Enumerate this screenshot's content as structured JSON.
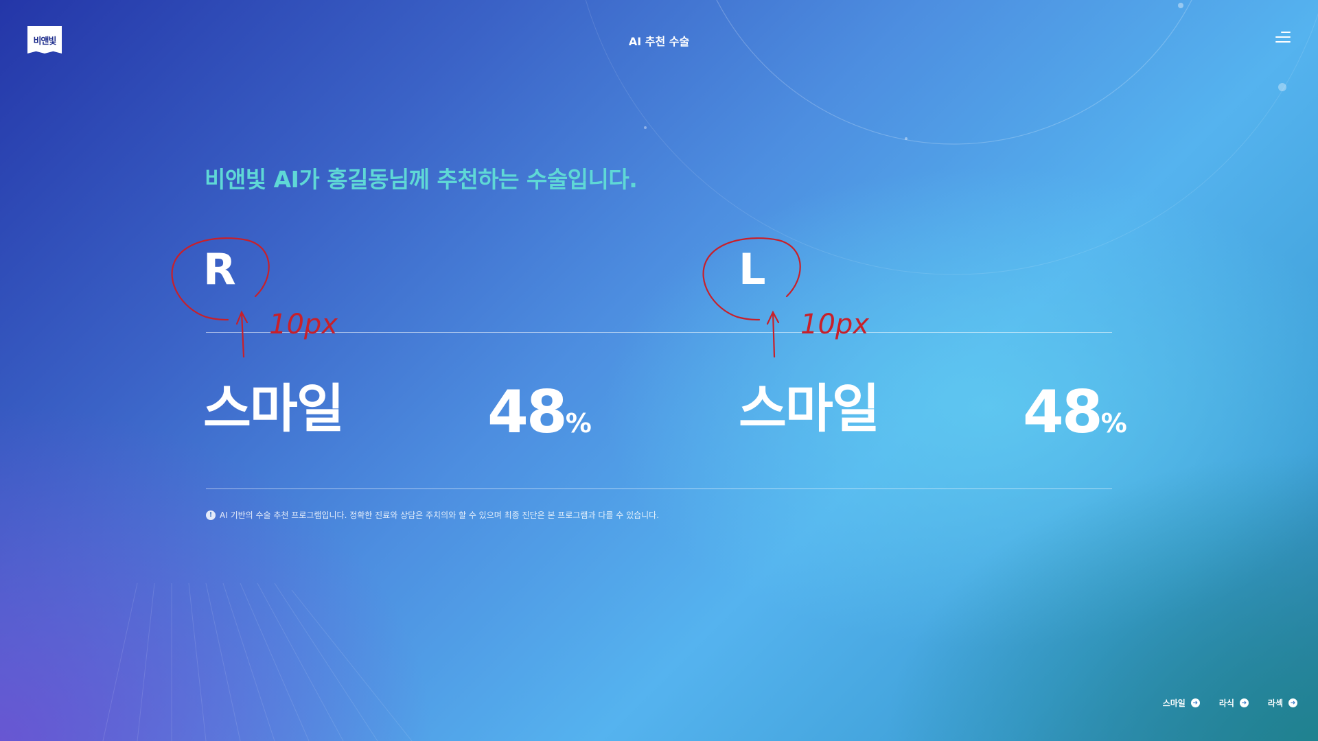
{
  "header": {
    "logo_text": "비앤빛",
    "title": "AI 추천 수술"
  },
  "main": {
    "headline": "비앤빛 AI가 홍길동님께 추천하는 수술입니다.",
    "eyes": [
      {
        "side": "R",
        "surgery": "스마일",
        "percent": "48",
        "percent_sign": "%"
      },
      {
        "side": "L",
        "surgery": "스마일",
        "percent": "48",
        "percent_sign": "%"
      }
    ],
    "notice": "AI 기반의 수술 추천 프로그램입니다. 정확한 진료와 상담은 주치의와 할 수 있으며 최종 진단은 본 프로그램과 다를 수 있습니다."
  },
  "annotations": {
    "spacing_note_1": "10px",
    "spacing_note_2": "10px"
  },
  "bottom_links": [
    "스마일",
    "라식",
    "라섹"
  ],
  "colors": {
    "headline": "#5fd8d6",
    "annotation": "#c8202a"
  }
}
